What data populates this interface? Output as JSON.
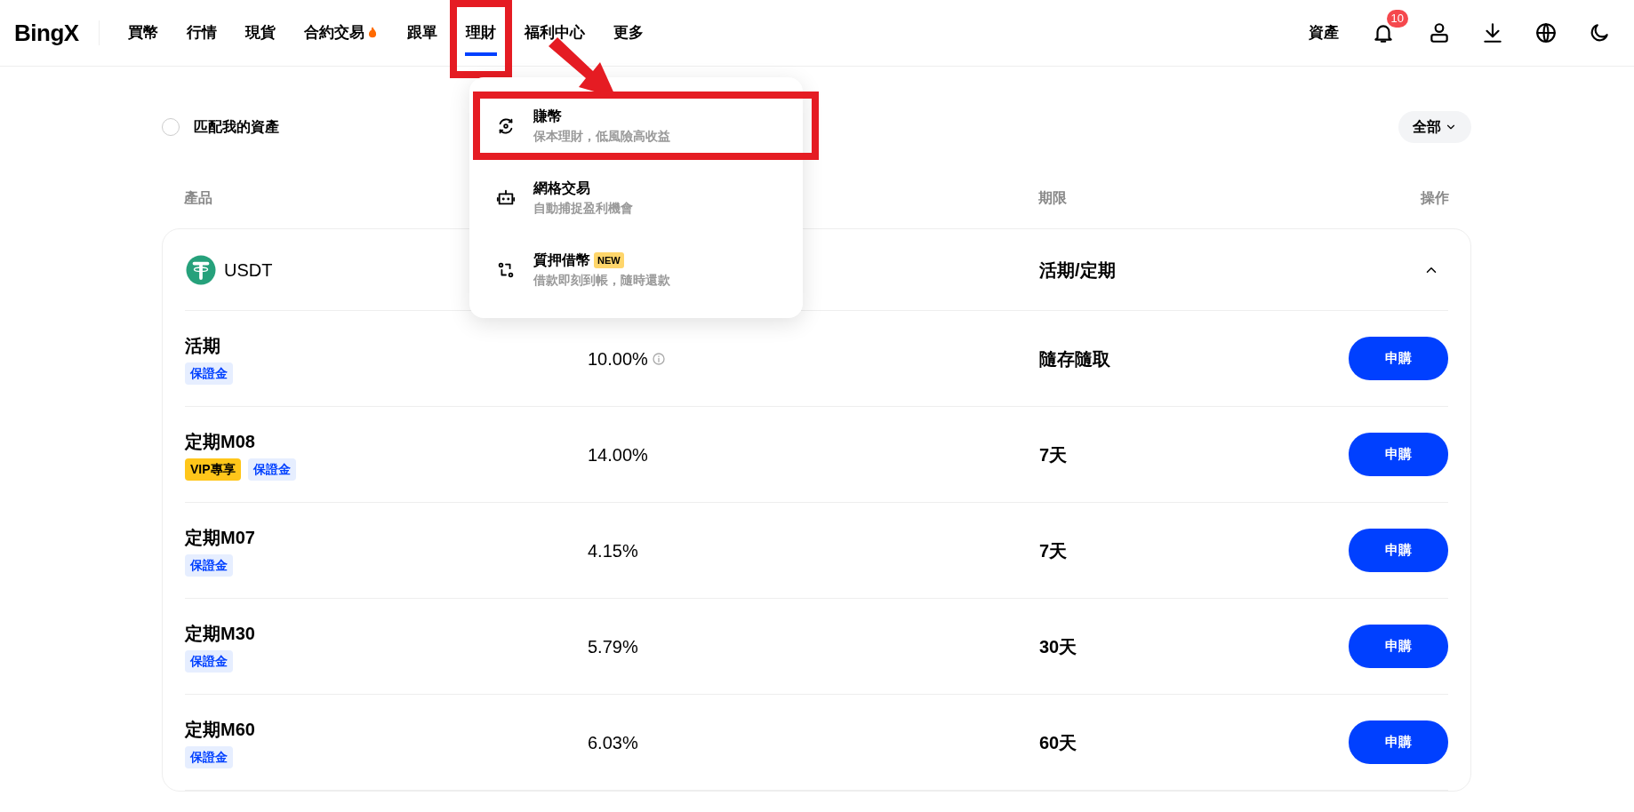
{
  "header": {
    "logo": "BingX",
    "nav": [
      {
        "label": "買幣",
        "selected": false,
        "hot": false,
        "highlighted": false
      },
      {
        "label": "行情",
        "selected": false,
        "hot": false,
        "highlighted": false
      },
      {
        "label": "現貨",
        "selected": false,
        "hot": false,
        "highlighted": false
      },
      {
        "label": "合約交易",
        "selected": false,
        "hot": true,
        "highlighted": false
      },
      {
        "label": "跟單",
        "selected": false,
        "hot": false,
        "highlighted": false
      },
      {
        "label": "理財",
        "selected": true,
        "hot": false,
        "highlighted": true
      },
      {
        "label": "福利中心",
        "selected": false,
        "hot": false,
        "highlighted": false
      },
      {
        "label": "更多",
        "selected": false,
        "hot": false,
        "highlighted": false
      }
    ],
    "assets_link": "資產",
    "notification_count": "10"
  },
  "dropdown": {
    "items": [
      {
        "kind": "earn",
        "title": "賺幣",
        "subtitle": "保本理財，低風險高收益",
        "highlighted": true
      },
      {
        "kind": "grid",
        "title": "網格交易",
        "subtitle": "自動捕捉盈利機會",
        "highlighted": false
      },
      {
        "kind": "loan",
        "title": "質押借幣",
        "badge": "NEW",
        "subtitle": "借款即刻到帳，隨時還款",
        "highlighted": false
      }
    ]
  },
  "annotation_arrow": true,
  "filter": {
    "checkbox_label": "匹配我的資產",
    "checked": false,
    "dropdown": "全部"
  },
  "table": {
    "columns": [
      {
        "label": "產品",
        "kind": "product"
      },
      {
        "label": "期限",
        "kind": "term"
      },
      {
        "label": "操作",
        "kind": "action"
      }
    ],
    "group": {
      "coin": "USDT",
      "term": "活期/定期",
      "expanded": true
    },
    "rows": [
      {
        "name": "活期",
        "tags": [
          {
            "kind": "margin",
            "label": "保證金"
          }
        ],
        "apr": "10.00%",
        "info": true,
        "term": "隨存隨取",
        "action": "申購"
      },
      {
        "name": "定期M08",
        "tags": [
          {
            "kind": "vip",
            "label": "VIP專享"
          },
          {
            "kind": "margin",
            "label": "保證金"
          }
        ],
        "apr": "14.00%",
        "info": false,
        "term": "7天",
        "action": "申購"
      },
      {
        "name": "定期M07",
        "tags": [
          {
            "kind": "margin",
            "label": "保證金"
          }
        ],
        "apr": "4.15%",
        "info": false,
        "term": "7天",
        "action": "申購"
      },
      {
        "name": "定期M30",
        "tags": [
          {
            "kind": "margin",
            "label": "保證金"
          }
        ],
        "apr": "5.79%",
        "info": false,
        "term": "30天",
        "action": "申購"
      },
      {
        "name": "定期M60",
        "tags": [
          {
            "kind": "margin",
            "label": "保證金"
          }
        ],
        "apr": "6.03%",
        "info": false,
        "term": "60天",
        "action": "申購"
      }
    ]
  }
}
